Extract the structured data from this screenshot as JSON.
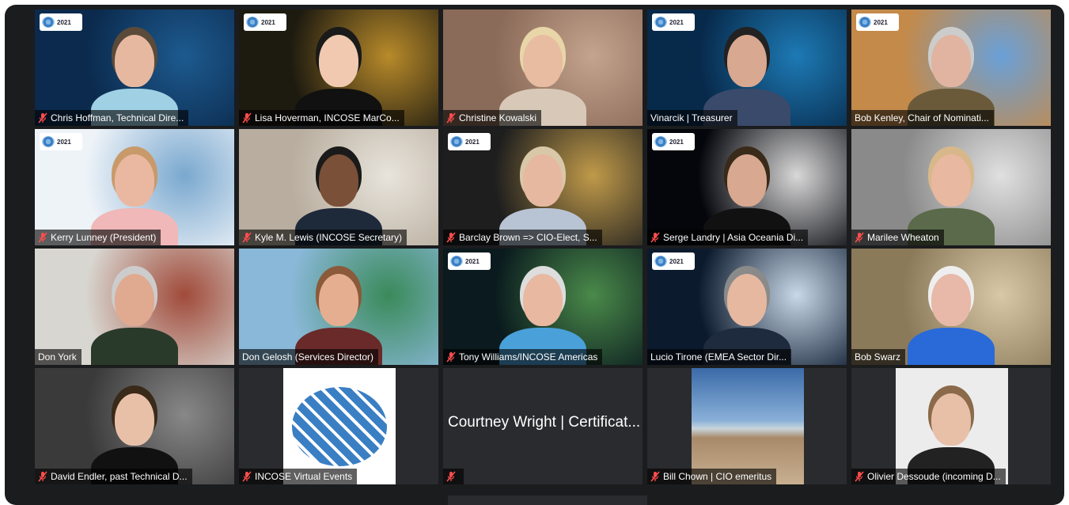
{
  "logo_text": "2021",
  "participants": [
    {
      "name": "Chris Hoffman, Technical Dire...",
      "muted": true,
      "logo": true,
      "bg": "#0b2a4d",
      "accent": "#1d5a8f",
      "skin": "#e7b8a0",
      "shirt": "#9fd0e4",
      "hair": "#5a4a3a"
    },
    {
      "name": "Lisa Hoverman, INCOSE MarCo...",
      "muted": true,
      "logo": true,
      "bg": "#1d1a10",
      "accent": "#b88a2a",
      "skin": "#f0c9b0",
      "shirt": "#111111",
      "hair": "#1a1a1a"
    },
    {
      "name": "Christine Kowalski",
      "muted": true,
      "logo": false,
      "bg": "#8a6a58",
      "accent": "#c4a48e",
      "skin": "#e8bca0",
      "shirt": "#d8c8b8",
      "hair": "#e8d6a8"
    },
    {
      "name": "Vinarcik | Treasurer",
      "muted": false,
      "logo": true,
      "bg": "#07294a",
      "accent": "#1d7ab5",
      "skin": "#d8a890",
      "shirt": "#3a4a6a",
      "hair": "#222222"
    },
    {
      "name": "Bob Kenley, Chair of Nominati...",
      "muted": false,
      "logo": true,
      "bg": "#c48a4a",
      "accent": "#6aa0d8",
      "skin": "#e0b4a0",
      "shirt": "#6a5a3a",
      "hair": "#cccccc",
      "active": true
    },
    {
      "name": "Kerry Lunney (President)",
      "muted": true,
      "logo": true,
      "bg": "#eef3f8",
      "accent": "#7aa8cf",
      "skin": "#eab8a0",
      "shirt": "#f0b8b8",
      "hair": "#c89a6a"
    },
    {
      "name": "Kyle M. Lewis (INCOSE Secretary)",
      "muted": true,
      "logo": false,
      "bg": "#b8ad9e",
      "accent": "#e8e4dc",
      "skin": "#7a5038",
      "shirt": "#1e2a3a",
      "hair": "#1a1a1a"
    },
    {
      "name": "Barclay Brown => CIO-Elect, S...",
      "muted": true,
      "logo": true,
      "bg": "#1e1e1e",
      "accent": "#c09a4a",
      "skin": "#e6b8a0",
      "shirt": "#b8c4d4",
      "hair": "#d8c8a8"
    },
    {
      "name": "Serge Landry | Asia Oceania Di...",
      "muted": true,
      "logo": true,
      "bg": "#05060c",
      "accent": "#d8d8d8",
      "skin": "#d8a890",
      "shirt": "#111111",
      "hair": "#3a2a1a"
    },
    {
      "name": "Marilee Wheaton",
      "muted": true,
      "logo": false,
      "bg": "#8a8a8a",
      "accent": "#e0e0e0",
      "skin": "#e8b8a0",
      "shirt": "#5a6a4a",
      "hair": "#d8b88a"
    },
    {
      "name": "Don York",
      "muted": false,
      "logo": false,
      "bg": "#d8d6d0",
      "accent": "#a04a3a",
      "skin": "#e0aa90",
      "shirt": "#2a3a2a",
      "hair": "#cccccc"
    },
    {
      "name": "Don Gelosh (Services Director)",
      "muted": false,
      "logo": false,
      "bg": "#8ab8d8",
      "accent": "#3a8a5a",
      "skin": "#e6ae90",
      "shirt": "#6a2a2a",
      "hair": "#8a5a3a"
    },
    {
      "name": "Tony Williams/INCOSE Americas",
      "muted": true,
      "logo": true,
      "bg": "#0a1a1e",
      "accent": "#4a8a4a",
      "skin": "#e8b8a0",
      "shirt": "#4aa0d8",
      "hair": "#dddddd"
    },
    {
      "name": "Lucio Tirone (EMEA Sector Dir...",
      "muted": false,
      "logo": true,
      "bg": "#0c1a2e",
      "accent": "#c8d8e8",
      "skin": "#e6b8a0",
      "shirt": "#1e2a3e",
      "hair": "#8a8a8a"
    },
    {
      "name": "Bob Swarz",
      "muted": false,
      "logo": false,
      "bg": "#8a7a5a",
      "accent": "#d8c8a8",
      "skin": "#e8b8a8",
      "shirt": "#2a6ad8",
      "hair": "#eeeeee"
    },
    {
      "name": "David Endler, past Technical D...",
      "muted": true,
      "logo": false,
      "bg": "#3a3a3a",
      "accent": "#888888",
      "skin": "#e8c0a8",
      "shirt": "#111111",
      "hair": "#3a2a1a"
    },
    {
      "name": "INCOSE Virtual Events",
      "muted": true,
      "logo": false,
      "bg": "#2a2b2e",
      "accent": "#3a7fc4",
      "skin": "",
      "shirt": "",
      "hair": "",
      "image": "incose-logo"
    },
    {
      "name": "",
      "muted": true,
      "logo": false,
      "bg": "#2a2b2e",
      "accent": "",
      "skin": "",
      "shirt": "",
      "hair": "",
      "center_text": "Courtney Wright | Certificat..."
    },
    {
      "name": "Bill Chown | CIO emeritus",
      "muted": true,
      "logo": false,
      "bg": "#2a2b2e",
      "accent": "#6a9ad0",
      "skin": "",
      "shirt": "",
      "hair": "",
      "image": "beach"
    },
    {
      "name": "Olivier Dessoude (incoming D...",
      "muted": true,
      "logo": false,
      "bg": "#2a2b2e",
      "accent": "#e8e8e8",
      "skin": "#e8c0a8",
      "shirt": "#222222",
      "hair": "#8a6a4a",
      "image": "portrait"
    }
  ]
}
